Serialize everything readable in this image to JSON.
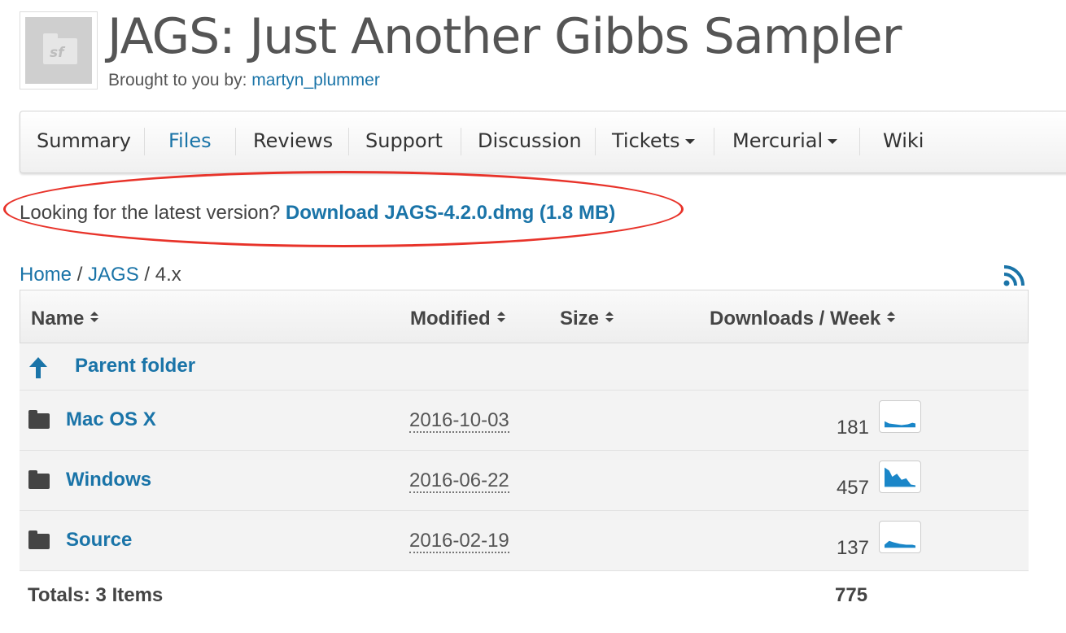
{
  "header": {
    "logo_text": "sf",
    "title": "JAGS: Just Another Gibbs Sampler",
    "byline_prefix": "Brought to you by:",
    "byline_author": "martyn_plummer"
  },
  "nav": {
    "items": [
      {
        "label": "Summary",
        "active": false
      },
      {
        "label": "Files",
        "active": true
      },
      {
        "label": "Reviews",
        "active": false
      },
      {
        "label": "Support",
        "active": false
      },
      {
        "label": "Discussion",
        "active": false
      },
      {
        "label": "Tickets",
        "active": false,
        "dropdown": true
      },
      {
        "label": "Mercurial",
        "active": false,
        "dropdown": true
      },
      {
        "label": "Wiki",
        "active": false
      }
    ]
  },
  "latest": {
    "prompt": "Looking for the latest version?",
    "link": "Download JAGS-4.2.0.dmg (1.8 MB)"
  },
  "breadcrumb": {
    "home": "Home",
    "sep1": " / ",
    "project": "JAGS",
    "sep2": " / ",
    "current": "4.x"
  },
  "table": {
    "headers": {
      "name": "Name",
      "modified": "Modified",
      "size": "Size",
      "downloads": "Downloads / Week"
    },
    "parent_label": "Parent folder",
    "rows": [
      {
        "name": "Mac OS X",
        "modified": "2016-10-03",
        "downloads": "181"
      },
      {
        "name": "Windows",
        "modified": "2016-06-22",
        "downloads": "457"
      },
      {
        "name": "Source",
        "modified": "2016-02-19",
        "downloads": "137"
      }
    ],
    "totals_label": "Totals: 3 Items",
    "totals_value": "775"
  },
  "colors": {
    "link": "#1a74a8",
    "annotation": "#e8332a",
    "sparkline": "#1a86c8"
  }
}
